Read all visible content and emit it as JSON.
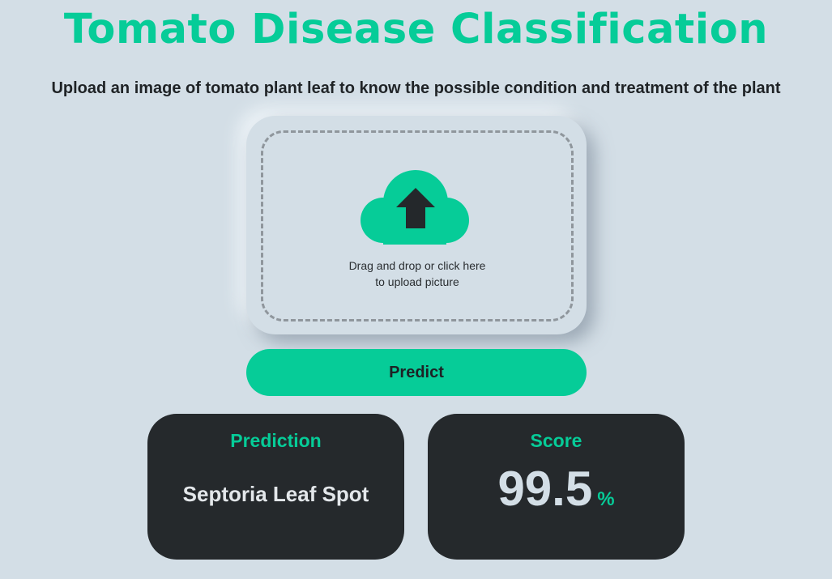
{
  "header": {
    "title": "Tomato Disease Classification",
    "subtitle": "Upload an image of tomato plant leaf to know the possible condition and treatment of the plant"
  },
  "upload": {
    "icon": "cloud-upload-icon",
    "line1": "Drag and drop or click here",
    "line2": "to upload picture"
  },
  "actions": {
    "predict_label": "Predict"
  },
  "results": {
    "prediction_heading": "Prediction",
    "prediction_value": "Septoria Leaf Spot",
    "score_heading": "Score",
    "score_value": "99.5",
    "score_unit": "%"
  },
  "colors": {
    "background": "#d3dee6",
    "accent": "#06cc98",
    "card": "#25292c",
    "text_dark": "#1f2326"
  }
}
